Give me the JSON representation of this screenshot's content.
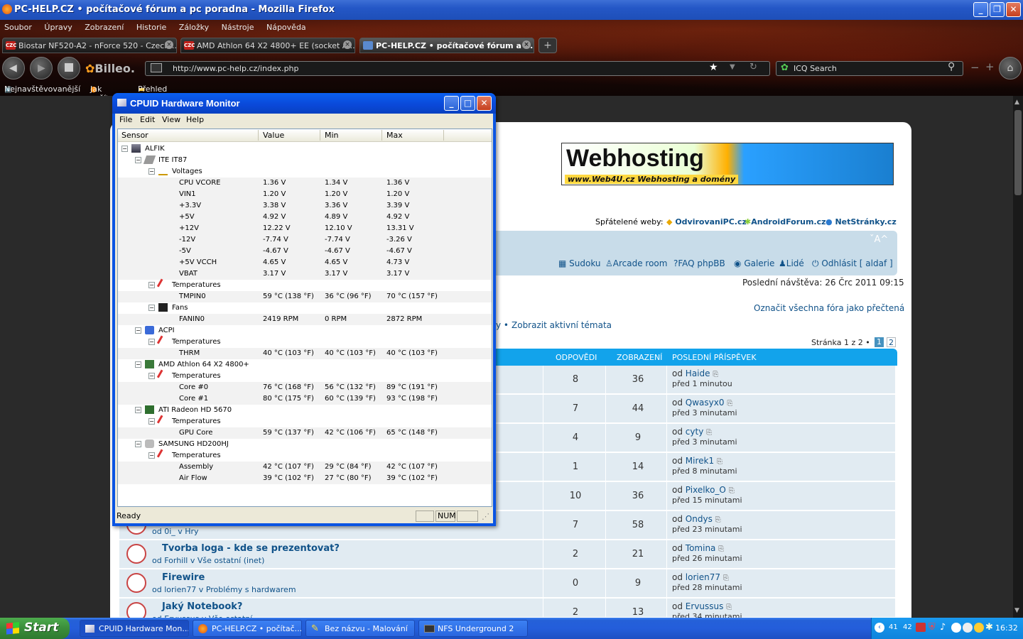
{
  "browser": {
    "title": "PC-HELP.CZ • počítačové fórum a pc poradna - Mozilla Firefox",
    "menu": [
      "Soubor",
      "Úpravy",
      "Zobrazení",
      "Historie",
      "Záložky",
      "Nástroje",
      "Nápověda"
    ],
    "tabs": [
      {
        "label": "Biostar NF520-A2 - nForce 520 - Czech ...",
        "fav": "CZC"
      },
      {
        "label": "AMD Athlon 64 X2 4800+ EE (socket A...",
        "fav": "CZC"
      },
      {
        "label": "PC-HELP.CZ • počítačové fórum a ...",
        "fav": ""
      }
    ],
    "addon": "Billeo.",
    "url": "http://www.pc-help.cz/index.php",
    "search_placeholder": "ICQ Search",
    "bookmarks": [
      "Nejnavštěvovanější",
      "Jak začít",
      "Přehled zpráv"
    ]
  },
  "forum": {
    "banner_title": "Webhosting",
    "banner_sub": "www.Web4U.cz  Webhosting a domény",
    "friendly_label": "Spřátelené weby:",
    "friendly_sites": [
      "OdvirovaniPC.cz",
      "AndroidForum.cz",
      "NetStránky.cz"
    ],
    "font_ctrl": "ˇA^",
    "nav": [
      "Sudoku",
      "Arcade room",
      "FAQ phpBB",
      "Galerie",
      "Lidé",
      "Odhlásit [ aldaf ]"
    ],
    "last_visit": "Poslední návštěva: 26 Črc 2011 09:15",
    "mark_read": "Označit všechna fóra jako přečtená",
    "active_topics_prefix": "y •",
    "active_topics": "Zobrazit aktivní témata",
    "pagination": "Stránka 1 z 2 •",
    "pages": [
      "1",
      "2"
    ],
    "columns": [
      "ODPOVĚDI",
      "ZOBRAZENÍ",
      "POSLEDNÍ PŘÍSPĚVEK"
    ],
    "rows": [
      {
        "title": "",
        "sub": "",
        "replies": "8",
        "views": "36",
        "by": "Haide",
        "when": "před 1 minutou"
      },
      {
        "title": "",
        "sub": "",
        "replies": "7",
        "views": "44",
        "by": "Qwasyx0",
        "when": "před 3 minutami"
      },
      {
        "title": "",
        "sub": "",
        "replies": "4",
        "views": "9",
        "by": "cyty",
        "when": "před 3 minutami"
      },
      {
        "title": "",
        "sub": "",
        "replies": "1",
        "views": "14",
        "by": "Mirek1",
        "when": "před 8 minutami"
      },
      {
        "title": "",
        "sub": "",
        "replies": "10",
        "views": "36",
        "by": "Pixelko_O",
        "when": "před 15 minutami"
      },
      {
        "title": "",
        "sub": "od 0i_ v Hry",
        "replies": "7",
        "views": "58",
        "by": "Ondys",
        "when": "před 23 minutami"
      },
      {
        "title": "Tvorba loga - kde se prezentovat?",
        "sub": "od Forhill v Vše ostatní (inet)",
        "replies": "2",
        "views": "21",
        "by": "Tomina",
        "when": "před 26 minutami"
      },
      {
        "title": "Firewire",
        "sub": "od lorien77 v Problémy s hardwarem",
        "replies": "0",
        "views": "9",
        "by": "lorien77",
        "when": "před 28 minutami"
      },
      {
        "title": "Jaký Notebook?",
        "sub": "od Ervussus v Vše ostatní",
        "replies": "2",
        "views": "13",
        "by": "Ervussus",
        "when": "před 34 minutami"
      }
    ],
    "by_prefix": "od"
  },
  "hwmonitor": {
    "title": "CPUID Hardware Monitor",
    "menu": [
      "File",
      "Edit",
      "View",
      "Help"
    ],
    "columns": [
      "Sensor",
      "Value",
      "Min",
      "Max"
    ],
    "rows": [
      {
        "level": 0,
        "exp": "-",
        "icon": "computer-icon",
        "name": "ALFIK",
        "v": "",
        "min": "",
        "max": ""
      },
      {
        "level": 1,
        "exp": "-",
        "icon": "chip-icon",
        "name": "ITE IT87",
        "v": "",
        "min": "",
        "max": ""
      },
      {
        "level": 2,
        "exp": "-",
        "icon": "voltage-icon",
        "name": "Voltages",
        "v": "",
        "min": "",
        "max": ""
      },
      {
        "level": 3,
        "name": "CPU VCORE",
        "v": "1.36 V",
        "min": "1.34 V",
        "max": "1.36 V"
      },
      {
        "level": 3,
        "name": "VIN1",
        "v": "1.20 V",
        "min": "1.20 V",
        "max": "1.20 V"
      },
      {
        "level": 3,
        "name": "+3.3V",
        "v": "3.38 V",
        "min": "3.36 V",
        "max": "3.39 V"
      },
      {
        "level": 3,
        "name": "+5V",
        "v": "4.92 V",
        "min": "4.89 V",
        "max": "4.92 V"
      },
      {
        "level": 3,
        "name": "+12V",
        "v": "12.22 V",
        "min": "12.10 V",
        "max": "13.31 V"
      },
      {
        "level": 3,
        "name": "-12V",
        "v": "-7.74 V",
        "min": "-7.74 V",
        "max": "-3.26 V"
      },
      {
        "level": 3,
        "name": "-5V",
        "v": "-4.67 V",
        "min": "-4.67 V",
        "max": "-4.67 V"
      },
      {
        "level": 3,
        "name": "+5V VCCH",
        "v": "4.65 V",
        "min": "4.65 V",
        "max": "4.73 V"
      },
      {
        "level": 3,
        "name": "VBAT",
        "v": "3.17 V",
        "min": "3.17 V",
        "max": "3.17 V"
      },
      {
        "level": 2,
        "exp": "-",
        "icon": "thermometer-icon",
        "name": "Temperatures",
        "v": "",
        "min": "",
        "max": ""
      },
      {
        "level": 3,
        "name": "TMPIN0",
        "v": "59 °C  (138 °F)",
        "min": "36 °C  (96 °F)",
        "max": "70 °C  (157 °F)"
      },
      {
        "level": 2,
        "exp": "-",
        "icon": "fan-icon",
        "name": "Fans",
        "v": "",
        "min": "",
        "max": ""
      },
      {
        "level": 3,
        "name": "FANIN0",
        "v": "2419 RPM",
        "min": "0 RPM",
        "max": "2872 RPM"
      },
      {
        "level": 1,
        "exp": "-",
        "icon": "acpi-icon",
        "name": "ACPI",
        "v": "",
        "min": "",
        "max": ""
      },
      {
        "level": 2,
        "exp": "-",
        "icon": "thermometer-icon",
        "name": "Temperatures",
        "v": "",
        "min": "",
        "max": ""
      },
      {
        "level": 3,
        "name": "THRM",
        "v": "40 °C  (103 °F)",
        "min": "40 °C  (103 °F)",
        "max": "40 °C  (103 °F)"
      },
      {
        "level": 1,
        "exp": "-",
        "icon": "cpu-icon",
        "name": "AMD Athlon 64 X2 4800+",
        "v": "",
        "min": "",
        "max": ""
      },
      {
        "level": 2,
        "exp": "-",
        "icon": "thermometer-icon",
        "name": "Temperatures",
        "v": "",
        "min": "",
        "max": ""
      },
      {
        "level": 3,
        "name": "Core #0",
        "v": "76 °C  (168 °F)",
        "min": "56 °C  (132 °F)",
        "max": "89 °C  (191 °F)"
      },
      {
        "level": 3,
        "name": "Core #1",
        "v": "80 °C  (175 °F)",
        "min": "60 °C  (139 °F)",
        "max": "93 °C  (198 °F)"
      },
      {
        "level": 1,
        "exp": "-",
        "icon": "gpu-icon",
        "name": "ATI Radeon HD 5670",
        "v": "",
        "min": "",
        "max": ""
      },
      {
        "level": 2,
        "exp": "-",
        "icon": "thermometer-icon",
        "name": "Temperatures",
        "v": "",
        "min": "",
        "max": ""
      },
      {
        "level": 3,
        "name": "GPU Core",
        "v": "59 °C  (137 °F)",
        "min": "42 °C  (106 °F)",
        "max": "65 °C  (148 °F)"
      },
      {
        "level": 1,
        "exp": "-",
        "icon": "hdd-icon",
        "name": "SAMSUNG HD200HJ",
        "v": "",
        "min": "",
        "max": ""
      },
      {
        "level": 2,
        "exp": "-",
        "icon": "thermometer-icon",
        "name": "Temperatures",
        "v": "",
        "min": "",
        "max": ""
      },
      {
        "level": 3,
        "name": "Assembly",
        "v": "42 °C  (107 °F)",
        "min": "29 °C  (84 °F)",
        "max": "42 °C  (107 °F)"
      },
      {
        "level": 3,
        "name": "Air Flow",
        "v": "39 °C  (102 °F)",
        "min": "27 °C  (80 °F)",
        "max": "39 °C  (102 °F)"
      }
    ],
    "status": "Ready",
    "num": "NUM"
  },
  "taskbar": {
    "start": "Start",
    "tasks": [
      "CPUID Hardware Mon...",
      "PC-HELP.CZ • počítač...",
      "Bez názvu - Malování",
      "NFS Underground 2"
    ],
    "tray_nums": [
      "41",
      "42"
    ],
    "clock": "16:32"
  }
}
